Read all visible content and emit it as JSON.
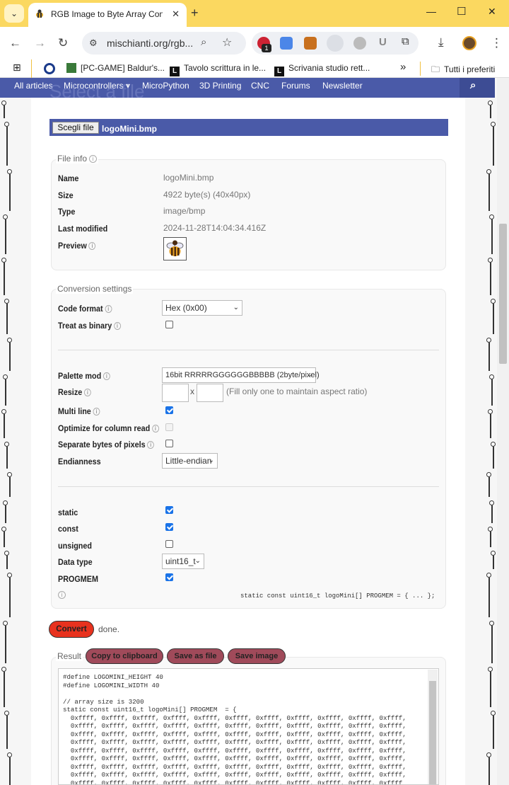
{
  "browser": {
    "tab_title": "RGB Image to Byte Array Conve",
    "url": "mischianti.org/rgb...",
    "ext_badge": "1",
    "bookmarks": [
      {
        "label": "[PC-GAME] Baldur's..."
      },
      {
        "label": "Tavolo scrittura in le..."
      },
      {
        "label": "Scrivania studio rett..."
      }
    ],
    "bookmarks_more": "»",
    "all_bookmarks": "Tutti i preferiti"
  },
  "sitenav": {
    "ghost_heading": "Select a file",
    "links": [
      "All articles",
      "Microcontrollers",
      "MicroPython",
      "3D Printing",
      "CNC",
      "Forums",
      "Newsletter"
    ]
  },
  "file": {
    "choose_label": "Scegli file",
    "filename": "logoMini.bmp"
  },
  "file_info": {
    "legend": "File info",
    "rows": [
      {
        "label": "Name",
        "value": "logoMini.bmp"
      },
      {
        "label": "Size",
        "value": "4922 byte(s) (40x40px)"
      },
      {
        "label": "Type",
        "value": "image/bmp"
      },
      {
        "label": "Last modified",
        "value": "2024-11-28T14:04:34.416Z"
      }
    ],
    "preview_label": "Preview"
  },
  "settings": {
    "legend": "Conversion settings",
    "code_format": {
      "label": "Code format",
      "value": "Hex (0x00)"
    },
    "treat_binary": {
      "label": "Treat as binary",
      "checked": false
    },
    "palette": {
      "label": "Palette mod",
      "value": "16bit RRRRRGGGGGGBBBBB (2byte/pixel)"
    },
    "resize": {
      "label": "Resize",
      "x": "x",
      "hint": "(Fill only one to maintain aspect ratio)"
    },
    "multi_line": {
      "label": "Multi line",
      "checked": true
    },
    "optimize": {
      "label": "Optimize for column read",
      "checked": false
    },
    "separate": {
      "label": "Separate bytes of pixels",
      "checked": false
    },
    "endianness": {
      "label": "Endianness",
      "value": "Little-endian"
    },
    "static": {
      "label": "static",
      "checked": true
    },
    "const": {
      "label": "const",
      "checked": true
    },
    "unsigned": {
      "label": "unsigned",
      "checked": false
    },
    "data_type": {
      "label": "Data type",
      "value": "uint16_t"
    },
    "progmem": {
      "label": "PROGMEM",
      "checked": true
    },
    "signature": "static const uint16_t logoMini[] PROGMEM = { ... };"
  },
  "convert": {
    "label": "Convert",
    "status": "done."
  },
  "result": {
    "legend": "Result",
    "copy": "Copy to clipboard",
    "save_file": "Save as file",
    "save_image": "Save image",
    "code": "#define LOGOMINI_HEIGHT 40\n#define LOGOMINI_WIDTH 40\n\n// array size is 3200\nstatic const uint16_t logoMini[] PROGMEM  = {\n  0xffff, 0xffff, 0xffff, 0xffff, 0xffff, 0xffff, 0xffff, 0xffff, 0xffff, 0xffff, 0xffff,\n  0xffff, 0xffff, 0xffff, 0xffff, 0xffff, 0xffff, 0xffff, 0xffff, 0xffff, 0xffff, 0xffff,\n  0xffff, 0xffff, 0xffff, 0xffff, 0xffff, 0xffff, 0xffff, 0xffff, 0xffff, 0xffff, 0xffff,\n  0xffff, 0xffff, 0xffff, 0xffff, 0xffff, 0xffff, 0xffff, 0xffff, 0xffff, 0xffff, 0xffff,\n  0xffff, 0xffff, 0xffff, 0xffff, 0xffff, 0xffff, 0xffff, 0xffff, 0xffff, 0xffff, 0xffff,\n  0xffff, 0xffff, 0xffff, 0xffff, 0xffff, 0xffff, 0xffff, 0xffff, 0xffff, 0xffff, 0xffff,\n  0xffff, 0xffff, 0xffff, 0xffff, 0xffff, 0xffff, 0xffff, 0xffff, 0xffff, 0xffff, 0xffff,\n  0xffff, 0xffff, 0xffff, 0xffff, 0xffff, 0xffff, 0xffff, 0xffff, 0xffff, 0xffff, 0xffff,\n  0xffff, 0xffff, 0xffff, 0xffff, 0xffff, 0xffff, 0xffff, 0xffff, 0xffff, 0xffff, 0xffff"
  },
  "colors": {
    "accent": "#4a5aa8",
    "convert": "#e8321e",
    "action": "#a04a5a",
    "chrome": "#fbd860"
  }
}
